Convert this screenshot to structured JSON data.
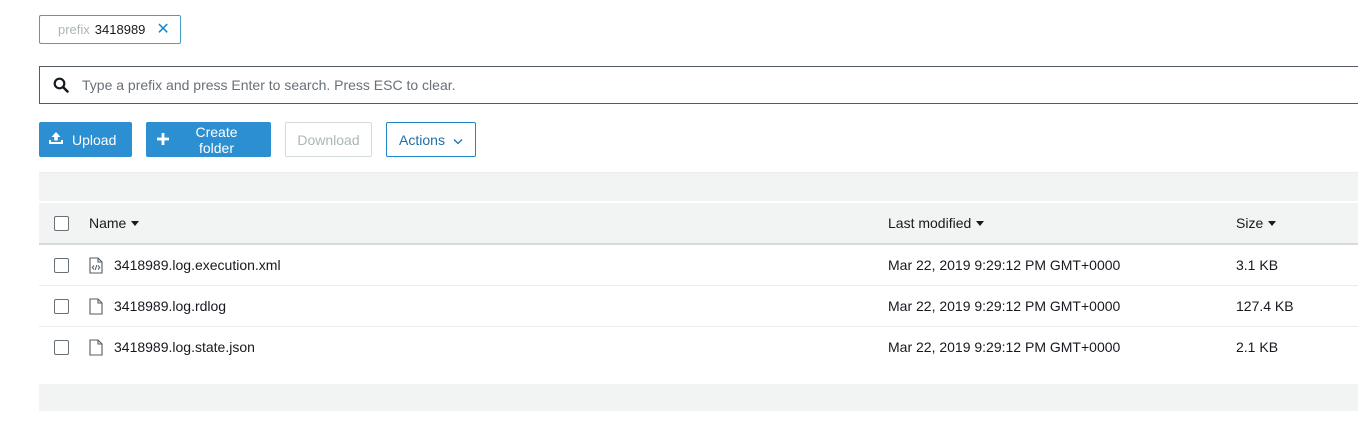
{
  "filter_chip": {
    "key": "prefix",
    "value": "3418989",
    "remove_glyph": "✕"
  },
  "search": {
    "placeholder": "Type a prefix and press Enter to search. Press ESC to clear.",
    "value": ""
  },
  "toolbar": {
    "upload_label": "Upload",
    "create_folder_label": "Create folder",
    "download_label": "Download",
    "actions_label": "Actions"
  },
  "table": {
    "columns": {
      "name": "Name",
      "modified": "Last modified",
      "size": "Size"
    },
    "rows": [
      {
        "name": "3418989.log.execution.xml",
        "modified": "Mar 22, 2019 9:29:12 PM GMT+0000",
        "size": "3.1 KB",
        "icon": "code-file-icon"
      },
      {
        "name": "3418989.log.rdlog",
        "modified": "Mar 22, 2019 9:29:12 PM GMT+0000",
        "size": "127.4 KB",
        "icon": "file-icon"
      },
      {
        "name": "3418989.log.state.json",
        "modified": "Mar 22, 2019 9:29:12 PM GMT+0000",
        "size": "2.1 KB",
        "icon": "file-icon"
      }
    ]
  },
  "colors": {
    "primary": "#2b8fd1",
    "link": "#1f86c9",
    "band": "#f2f3f3"
  }
}
